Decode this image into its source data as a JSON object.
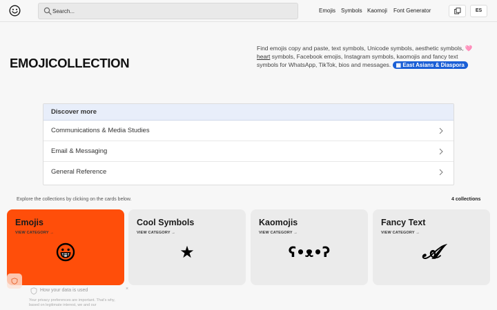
{
  "header": {
    "logo_icon": "smiley-face-icon",
    "search_placeholder": "Search...",
    "nav": [
      "Emojis",
      "Symbols",
      "Kaomoji",
      "Font Generator"
    ],
    "copy_icon": "copy-icon",
    "lang": "ES"
  },
  "hero": {
    "title": "EMOJICOLLECTION",
    "desc_part1": "Find emojis copy and paste, text symbols, Unicode symbols, aesthetic symbols, ",
    "desc_link": "heart",
    "desc_part2": " symbols, Facebook emojis, Instagram symbols, kaomojis and fancy text symbols for WhatsApp, TikTok, bios and messages.",
    "pill": "East Asians & Diaspora",
    "accent": "#1a5fd6"
  },
  "discover": {
    "title": "Discover more",
    "items": [
      "Communications & Media Studies",
      "Email & Messaging",
      "General Reference"
    ]
  },
  "collections": {
    "explore_text": "Explore the collections by clicking on the cards below.",
    "count": "4 collections",
    "view_label": "VIEW CATEGORY →",
    "cards": [
      {
        "title": "Emojis",
        "glyph_icon": "grinning-face-icon",
        "color": "#ff4e0a"
      },
      {
        "title": "Cool Symbols",
        "glyph": "★",
        "color": "#ebebeb"
      },
      {
        "title": "Kaomojis",
        "glyph": "ʕ•ᴥ•ʔ",
        "color": "#ebebeb"
      },
      {
        "title": "Fancy Text",
        "glyph": "𝓐",
        "color": "#ebebeb"
      }
    ]
  },
  "consent": {
    "title": "How your data is used",
    "text": "Your privacy preferences are important. That's why, based on legitimate interest, we and our"
  }
}
